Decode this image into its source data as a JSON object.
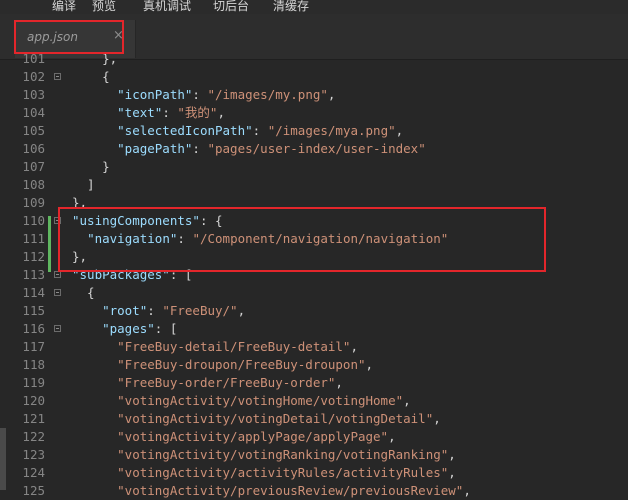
{
  "toolbar": {
    "items": [
      "编译",
      "预览",
      "真机调试",
      "切后台",
      "清缓存"
    ]
  },
  "tab": {
    "label": "app.json",
    "close": "×"
  },
  "lines": [
    {
      "n": "101",
      "fold": false,
      "tokens": [
        [
          "p",
          "    },"
        ]
      ]
    },
    {
      "n": "102",
      "fold": true,
      "tokens": [
        [
          "p",
          "    {"
        ]
      ]
    },
    {
      "n": "103",
      "fold": false,
      "tokens": [
        [
          "p",
          "      "
        ],
        [
          "k",
          "\"iconPath\""
        ],
        [
          "p",
          ": "
        ],
        [
          "s",
          "\"/images/my.png\""
        ],
        [
          "p",
          ","
        ]
      ]
    },
    {
      "n": "104",
      "fold": false,
      "tokens": [
        [
          "p",
          "      "
        ],
        [
          "k",
          "\"text\""
        ],
        [
          "p",
          ": "
        ],
        [
          "s",
          "\"我的\""
        ],
        [
          "p",
          ","
        ]
      ]
    },
    {
      "n": "105",
      "fold": false,
      "tokens": [
        [
          "p",
          "      "
        ],
        [
          "k",
          "\"selectedIconPath\""
        ],
        [
          "p",
          ": "
        ],
        [
          "s",
          "\"/images/mya.png\""
        ],
        [
          "p",
          ","
        ]
      ]
    },
    {
      "n": "106",
      "fold": false,
      "tokens": [
        [
          "p",
          "      "
        ],
        [
          "k",
          "\"pagePath\""
        ],
        [
          "p",
          ": "
        ],
        [
          "s",
          "\"pages/user-index/user-index\""
        ]
      ]
    },
    {
      "n": "107",
      "fold": false,
      "tokens": [
        [
          "p",
          "    }"
        ]
      ]
    },
    {
      "n": "108",
      "fold": false,
      "tokens": [
        [
          "p",
          "  ]"
        ]
      ]
    },
    {
      "n": "109",
      "fold": false,
      "tokens": [
        [
          "p",
          "},"
        ]
      ]
    },
    {
      "n": "110",
      "fold": true,
      "tokens": [
        [
          "k",
          "\"usingComponents\""
        ],
        [
          "p",
          ": {"
        ]
      ]
    },
    {
      "n": "111",
      "fold": false,
      "tokens": [
        [
          "p",
          "  "
        ],
        [
          "k",
          "\"navigation\""
        ],
        [
          "p",
          ": "
        ],
        [
          "s",
          "\"/Component/navigation/navigation\""
        ]
      ]
    },
    {
      "n": "112",
      "fold": false,
      "tokens": [
        [
          "p",
          "},"
        ]
      ]
    },
    {
      "n": "113",
      "fold": true,
      "tokens": [
        [
          "k",
          "\"subPackages\""
        ],
        [
          "p",
          ": ["
        ]
      ]
    },
    {
      "n": "114",
      "fold": true,
      "tokens": [
        [
          "p",
          "  {"
        ]
      ]
    },
    {
      "n": "115",
      "fold": false,
      "tokens": [
        [
          "p",
          "    "
        ],
        [
          "k",
          "\"root\""
        ],
        [
          "p",
          ": "
        ],
        [
          "s",
          "\"FreeBuy/\""
        ],
        [
          "p",
          ","
        ]
      ]
    },
    {
      "n": "116",
      "fold": true,
      "tokens": [
        [
          "p",
          "    "
        ],
        [
          "k",
          "\"pages\""
        ],
        [
          "p",
          ": ["
        ]
      ]
    },
    {
      "n": "117",
      "fold": false,
      "tokens": [
        [
          "p",
          "      "
        ],
        [
          "s",
          "\"FreeBuy-detail/FreeBuy-detail\""
        ],
        [
          "p",
          ","
        ]
      ]
    },
    {
      "n": "118",
      "fold": false,
      "tokens": [
        [
          "p",
          "      "
        ],
        [
          "s",
          "\"FreeBuy-droupon/FreeBuy-droupon\""
        ],
        [
          "p",
          ","
        ]
      ]
    },
    {
      "n": "119",
      "fold": false,
      "tokens": [
        [
          "p",
          "      "
        ],
        [
          "s",
          "\"FreeBuy-order/FreeBuy-order\""
        ],
        [
          "p",
          ","
        ]
      ]
    },
    {
      "n": "120",
      "fold": false,
      "tokens": [
        [
          "p",
          "      "
        ],
        [
          "s",
          "\"votingActivity/votingHome/votingHome\""
        ],
        [
          "p",
          ","
        ]
      ]
    },
    {
      "n": "121",
      "fold": false,
      "tokens": [
        [
          "p",
          "      "
        ],
        [
          "s",
          "\"votingActivity/votingDetail/votingDetail\""
        ],
        [
          "p",
          ","
        ]
      ]
    },
    {
      "n": "122",
      "fold": false,
      "tokens": [
        [
          "p",
          "      "
        ],
        [
          "s",
          "\"votingActivity/applyPage/applyPage\""
        ],
        [
          "p",
          ","
        ]
      ]
    },
    {
      "n": "123",
      "fold": false,
      "tokens": [
        [
          "p",
          "      "
        ],
        [
          "s",
          "\"votingActivity/votingRanking/votingRanking\""
        ],
        [
          "p",
          ","
        ]
      ]
    },
    {
      "n": "124",
      "fold": false,
      "tokens": [
        [
          "p",
          "      "
        ],
        [
          "s",
          "\"votingActivity/activityRules/activityRules\""
        ],
        [
          "p",
          ","
        ]
      ]
    },
    {
      "n": "125",
      "fold": false,
      "tokens": [
        [
          "p",
          "      "
        ],
        [
          "s",
          "\"votingActivity/previousReview/previousReview\""
        ],
        [
          "p",
          ","
        ]
      ]
    }
  ]
}
